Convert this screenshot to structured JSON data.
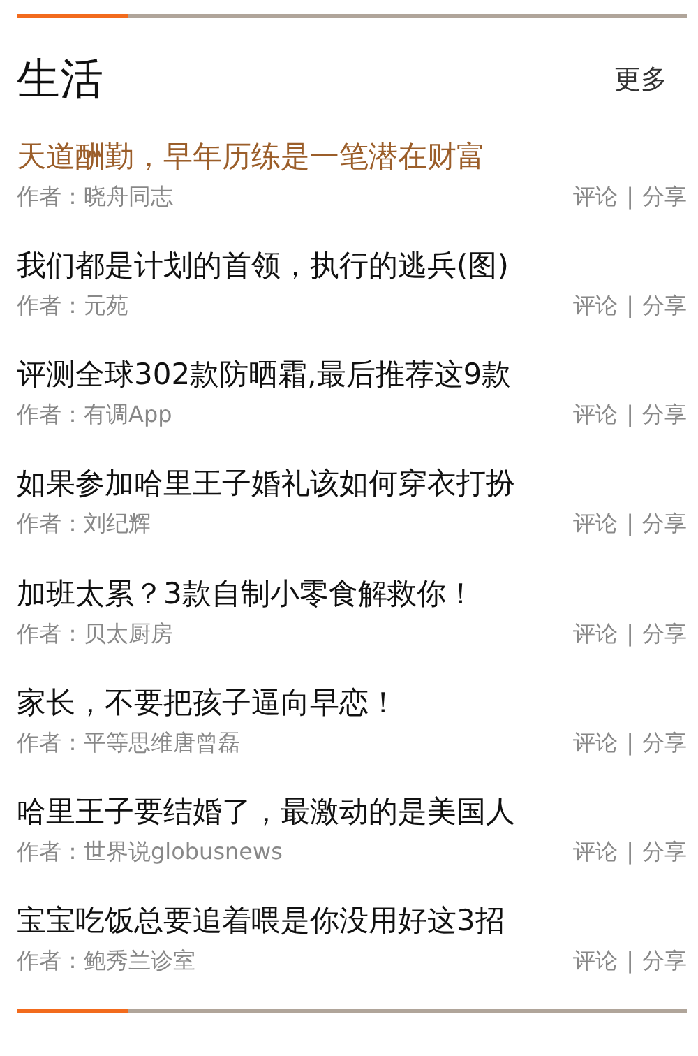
{
  "section": {
    "title": "生活",
    "more_link": "更多"
  },
  "articles": [
    {
      "title": "天道酬勤，早年历练是一笔潜在财富",
      "author": "作者：晓舟同志",
      "comment": "评论",
      "separator": "|",
      "share": "分享",
      "highlighted": true
    },
    {
      "title": "我们都是计划的首领，执行的逃兵(图)",
      "author": "作者：元苑",
      "comment": "评论",
      "separator": "|",
      "share": "分享",
      "highlighted": false
    },
    {
      "title": "评测全球302款防晒霜,最后推荐这9款",
      "author": "作者：有调App",
      "comment": "评论",
      "separator": "|",
      "share": "分享",
      "highlighted": false
    },
    {
      "title": "如果参加哈里王子婚礼该如何穿衣打扮",
      "author": "作者：刘纪辉",
      "comment": "评论",
      "separator": "|",
      "share": "分享",
      "highlighted": false
    },
    {
      "title": "加班太累？3款自制小零食解救你！",
      "author": "作者：贝太厨房",
      "comment": "评论",
      "separator": "|",
      "share": "分享",
      "highlighted": false
    },
    {
      "title": "家长，不要把孩子逼向早恋！",
      "author": "作者：平等思维唐曾磊",
      "comment": "评论",
      "separator": "|",
      "share": "分享",
      "highlighted": false
    },
    {
      "title": "哈里王子要结婚了，最激动的是美国人",
      "author": "作者：世界说globusnews",
      "comment": "评论",
      "separator": "|",
      "share": "分享",
      "highlighted": false
    },
    {
      "title": "宝宝吃饭总要追着喂是你没用好这3招",
      "author": "作者：鲍秀兰诊室",
      "comment": "评论",
      "separator": "|",
      "share": "分享",
      "highlighted": false
    }
  ]
}
